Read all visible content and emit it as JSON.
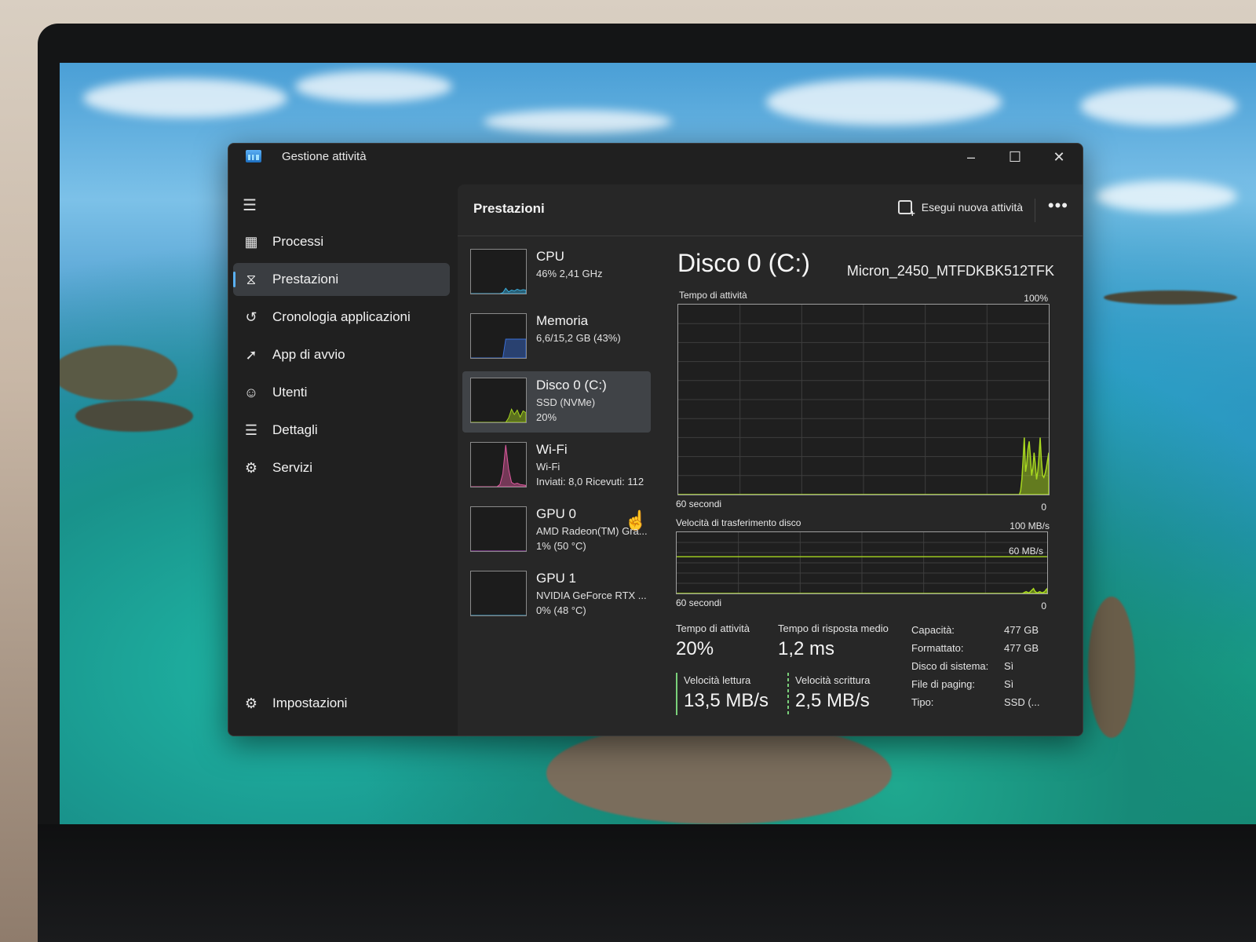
{
  "window": {
    "title": "Gestione attività",
    "controls": {
      "minimize": "–",
      "maximize": "☐",
      "close": "✕"
    }
  },
  "sidebar": {
    "items": [
      {
        "label": "Processi",
        "icon": "processes-icon",
        "active": false
      },
      {
        "label": "Prestazioni",
        "icon": "performance-icon",
        "active": true
      },
      {
        "label": "Cronologia applicazioni",
        "icon": "history-icon",
        "active": false
      },
      {
        "label": "App di avvio",
        "icon": "startup-icon",
        "active": false
      },
      {
        "label": "Utenti",
        "icon": "users-icon",
        "active": false
      },
      {
        "label": "Dettagli",
        "icon": "details-icon",
        "active": false
      },
      {
        "label": "Servizi",
        "icon": "services-icon",
        "active": false
      }
    ],
    "settings": {
      "label": "Impostazioni",
      "icon": "gear-icon"
    }
  },
  "header": {
    "title": "Prestazioni",
    "run_task": "Esegui nuova attività",
    "more": "•••"
  },
  "resources": [
    {
      "name": "CPU",
      "line1": "46% 2,41 GHz",
      "line2": "",
      "color": "#3ab0e0",
      "spark": [
        0,
        0,
        0,
        0,
        0,
        0,
        0,
        0,
        0,
        0,
        0,
        2,
        12,
        4,
        8,
        6,
        10,
        7,
        9,
        8
      ]
    },
    {
      "name": "Memoria",
      "line1": "6,6/15,2 GB (43%)",
      "line2": "",
      "color": "#3a6fd8",
      "spark": [
        0,
        0,
        0,
        0,
        0,
        0,
        0,
        0,
        0,
        0,
        0,
        0,
        43,
        43,
        43,
        43,
        43,
        43,
        43,
        43
      ]
    },
    {
      "name": "Disco 0 (C:)",
      "line1": "SSD (NVMe)",
      "line2": "20%",
      "color": "#a8d820",
      "spark": [
        0,
        0,
        0,
        0,
        0,
        0,
        0,
        0,
        0,
        0,
        0,
        0,
        0,
        10,
        30,
        18,
        28,
        12,
        26,
        22
      ],
      "selected": true
    },
    {
      "name": "Wi-Fi",
      "line1": "Wi-Fi",
      "line2": "Inviati: 8,0 Ricevuti: 112",
      "color": "#e05aa0",
      "spark": [
        0,
        0,
        0,
        0,
        0,
        0,
        0,
        0,
        0,
        0,
        5,
        30,
        95,
        40,
        10,
        6,
        8,
        5,
        4,
        3
      ]
    },
    {
      "name": "GPU 0",
      "line1": "AMD Radeon(TM) Gra...",
      "line2": "1% (50 °C)",
      "color": "#c04ad8",
      "spark": [
        0,
        0,
        0,
        0,
        0,
        0,
        0,
        0,
        0,
        0,
        0,
        0,
        0,
        0,
        0,
        0,
        0,
        0,
        0,
        0
      ]
    },
    {
      "name": "GPU 1",
      "line1": "NVIDIA GeForce RTX ...",
      "line2": "0% (48 °C)",
      "color": "#3ab0e0",
      "spark": [
        0,
        0,
        0,
        0,
        0,
        0,
        0,
        0,
        0,
        0,
        0,
        0,
        0,
        0,
        0,
        0,
        0,
        0,
        0,
        0
      ]
    }
  ],
  "detail": {
    "title": "Disco 0 (C:)",
    "model": "Micron_2450_MTFDKBK512TFK",
    "activity_chart": {
      "label": "Tempo di attività",
      "max_label": "100%",
      "time_label": "60 secondi",
      "min_label": "0",
      "color": "#a8d820",
      "values": [
        0,
        0,
        0,
        0,
        0,
        0,
        0,
        0,
        0,
        0,
        0,
        0,
        0,
        0,
        0,
        0,
        0,
        0,
        0,
        0,
        0,
        0,
        0,
        0,
        0,
        0,
        0,
        0,
        0,
        0,
        0,
        0,
        0,
        0,
        0,
        0,
        0,
        0,
        0,
        0,
        0,
        0,
        0,
        0,
        0,
        0,
        0,
        0,
        0,
        0,
        0,
        0,
        0,
        0,
        0,
        0,
        0,
        0,
        0,
        0,
        0,
        0,
        0,
        0,
        0,
        0,
        0,
        0,
        0,
        0,
        0,
        0,
        0,
        0,
        0,
        0,
        0,
        0,
        0,
        0,
        0,
        0,
        0,
        0,
        0,
        0,
        0,
        0,
        0,
        0,
        0,
        0,
        0,
        0,
        0,
        0,
        0,
        0,
        0,
        0,
        0,
        0,
        0,
        0,
        0,
        0,
        0,
        0,
        0,
        0,
        0,
        0,
        0,
        0,
        0,
        0,
        0,
        0,
        0,
        0,
        0,
        0,
        0,
        0,
        0,
        0,
        0,
        0,
        0,
        0,
        0,
        0,
        0,
        0,
        0,
        0,
        0,
        0,
        0,
        0,
        0,
        0,
        0,
        0,
        0,
        0,
        0,
        0,
        0,
        0,
        0,
        0,
        0,
        0,
        0,
        0,
        0,
        0,
        0,
        0,
        0,
        0,
        0,
        0,
        0,
        0,
        0,
        0,
        0,
        0,
        0,
        0,
        0,
        0,
        0,
        0,
        0,
        0,
        0,
        0,
        0,
        0,
        0,
        0,
        0,
        0,
        0,
        0,
        0,
        0,
        0,
        0,
        0,
        0,
        0,
        0,
        0,
        0,
        0,
        0,
        0,
        0,
        0,
        0,
        0,
        0,
        0,
        0,
        0,
        0,
        0,
        0,
        0,
        0,
        0,
        0,
        0,
        0,
        0,
        0,
        0,
        0,
        0,
        0,
        0,
        0,
        0,
        0,
        0,
        0,
        0,
        0,
        0,
        0,
        0,
        0,
        0,
        0,
        0,
        0,
        0,
        0,
        0,
        0,
        0,
        0,
        0,
        0,
        0,
        0,
        0,
        0,
        0,
        0,
        0,
        0,
        0,
        0,
        0,
        0,
        0,
        0,
        0,
        0,
        0,
        0,
        0,
        0,
        0,
        0,
        0,
        0,
        0,
        0,
        0,
        0,
        0,
        0,
        0,
        0,
        2,
        8,
        18,
        30,
        12,
        16,
        24,
        28,
        20,
        10,
        14,
        22,
        16,
        8,
        12,
        20,
        30,
        18,
        10,
        9,
        11,
        14,
        18,
        22
      ]
    },
    "transfer_chart": {
      "label": "Velocità di trasferimento disco",
      "max_label": "100 MB/s",
      "ref_label": "60 MB/s",
      "time_label": "60 secondi",
      "min_label": "0",
      "color": "#a8d820",
      "ref_value": 60,
      "values": [
        0,
        0,
        0,
        0,
        0,
        0,
        0,
        0,
        0,
        0,
        0,
        0,
        0,
        0,
        0,
        0,
        0,
        0,
        0,
        0,
        0,
        0,
        0,
        0,
        0,
        0,
        0,
        0,
        0,
        0,
        0,
        0,
        0,
        0,
        0,
        0,
        0,
        0,
        0,
        0,
        0,
        0,
        0,
        0,
        0,
        0,
        0,
        0,
        0,
        0,
        0,
        0,
        0,
        0,
        0,
        0,
        0,
        0,
        0,
        0,
        0,
        0,
        0,
        0,
        0,
        0,
        0,
        0,
        0,
        0,
        0,
        0,
        0,
        0,
        0,
        0,
        0,
        0,
        0,
        0,
        0,
        0,
        0,
        0,
        0,
        0,
        0,
        0,
        0,
        0,
        0,
        0,
        0,
        0,
        0,
        0,
        0,
        0,
        0,
        0,
        0,
        0,
        0,
        0,
        0,
        0,
        0,
        0,
        0,
        0,
        0,
        0,
        0,
        0,
        0,
        0,
        0,
        0,
        0,
        0,
        0,
        0,
        0,
        0,
        0,
        0,
        0,
        0,
        0,
        0,
        0,
        0,
        0,
        0,
        0,
        0,
        0,
        0,
        0,
        0,
        0,
        0,
        0,
        0,
        0,
        0,
        0,
        0,
        0,
        0,
        0,
        0,
        0,
        0,
        0,
        0,
        0,
        0,
        0,
        0,
        0,
        0,
        0,
        0,
        0,
        0,
        0,
        0,
        0,
        0,
        0,
        0,
        0,
        0,
        0,
        0,
        0,
        0,
        0,
        0,
        0,
        0,
        0,
        0,
        0,
        0,
        0,
        0,
        0,
        0,
        0,
        0,
        0,
        0,
        0,
        0,
        0,
        0,
        0,
        0,
        0,
        0,
        0,
        0,
        0,
        0,
        0,
        0,
        0,
        0,
        0,
        0,
        0,
        0,
        0,
        0,
        0,
        0,
        0,
        0,
        0,
        0,
        0,
        0,
        0,
        0,
        0,
        0,
        0,
        0,
        0,
        0,
        0,
        0,
        0,
        0,
        0,
        0,
        0,
        0,
        0,
        0,
        0,
        0,
        0,
        0,
        0,
        0,
        0,
        0,
        0,
        0,
        0,
        0,
        0,
        0,
        0,
        0,
        0,
        0,
        0,
        0,
        0,
        0,
        0,
        0,
        0,
        0,
        0,
        0,
        0,
        0,
        0,
        0,
        0,
        0,
        0,
        0,
        0,
        1,
        2,
        3,
        2,
        1,
        2,
        4,
        6,
        8,
        4,
        2,
        1,
        2,
        3,
        2,
        1,
        2,
        3,
        6,
        8
      ]
    },
    "stats": {
      "activity": {
        "label": "Tempo di attività",
        "value": "20%"
      },
      "response": {
        "label": "Tempo di risposta medio",
        "value": "1,2 ms"
      },
      "read": {
        "label": "Velocità lettura",
        "value": "13,5 MB/s"
      },
      "write": {
        "label": "Velocità scrittura",
        "value": "2,5 MB/s"
      }
    },
    "properties": [
      {
        "key": "Capacità:",
        "value": "477 GB"
      },
      {
        "key": "Formattato:",
        "value": "477 GB"
      },
      {
        "key": "Disco di sistema:",
        "value": "Sì"
      },
      {
        "key": "File di paging:",
        "value": "Sì"
      },
      {
        "key": "Tipo:",
        "value": "SSD (..."
      }
    ]
  },
  "colors": {
    "accent": "#5ab0f0",
    "disk_green": "#a8d820",
    "window_bg": "#202020",
    "panel_bg": "#272727"
  }
}
